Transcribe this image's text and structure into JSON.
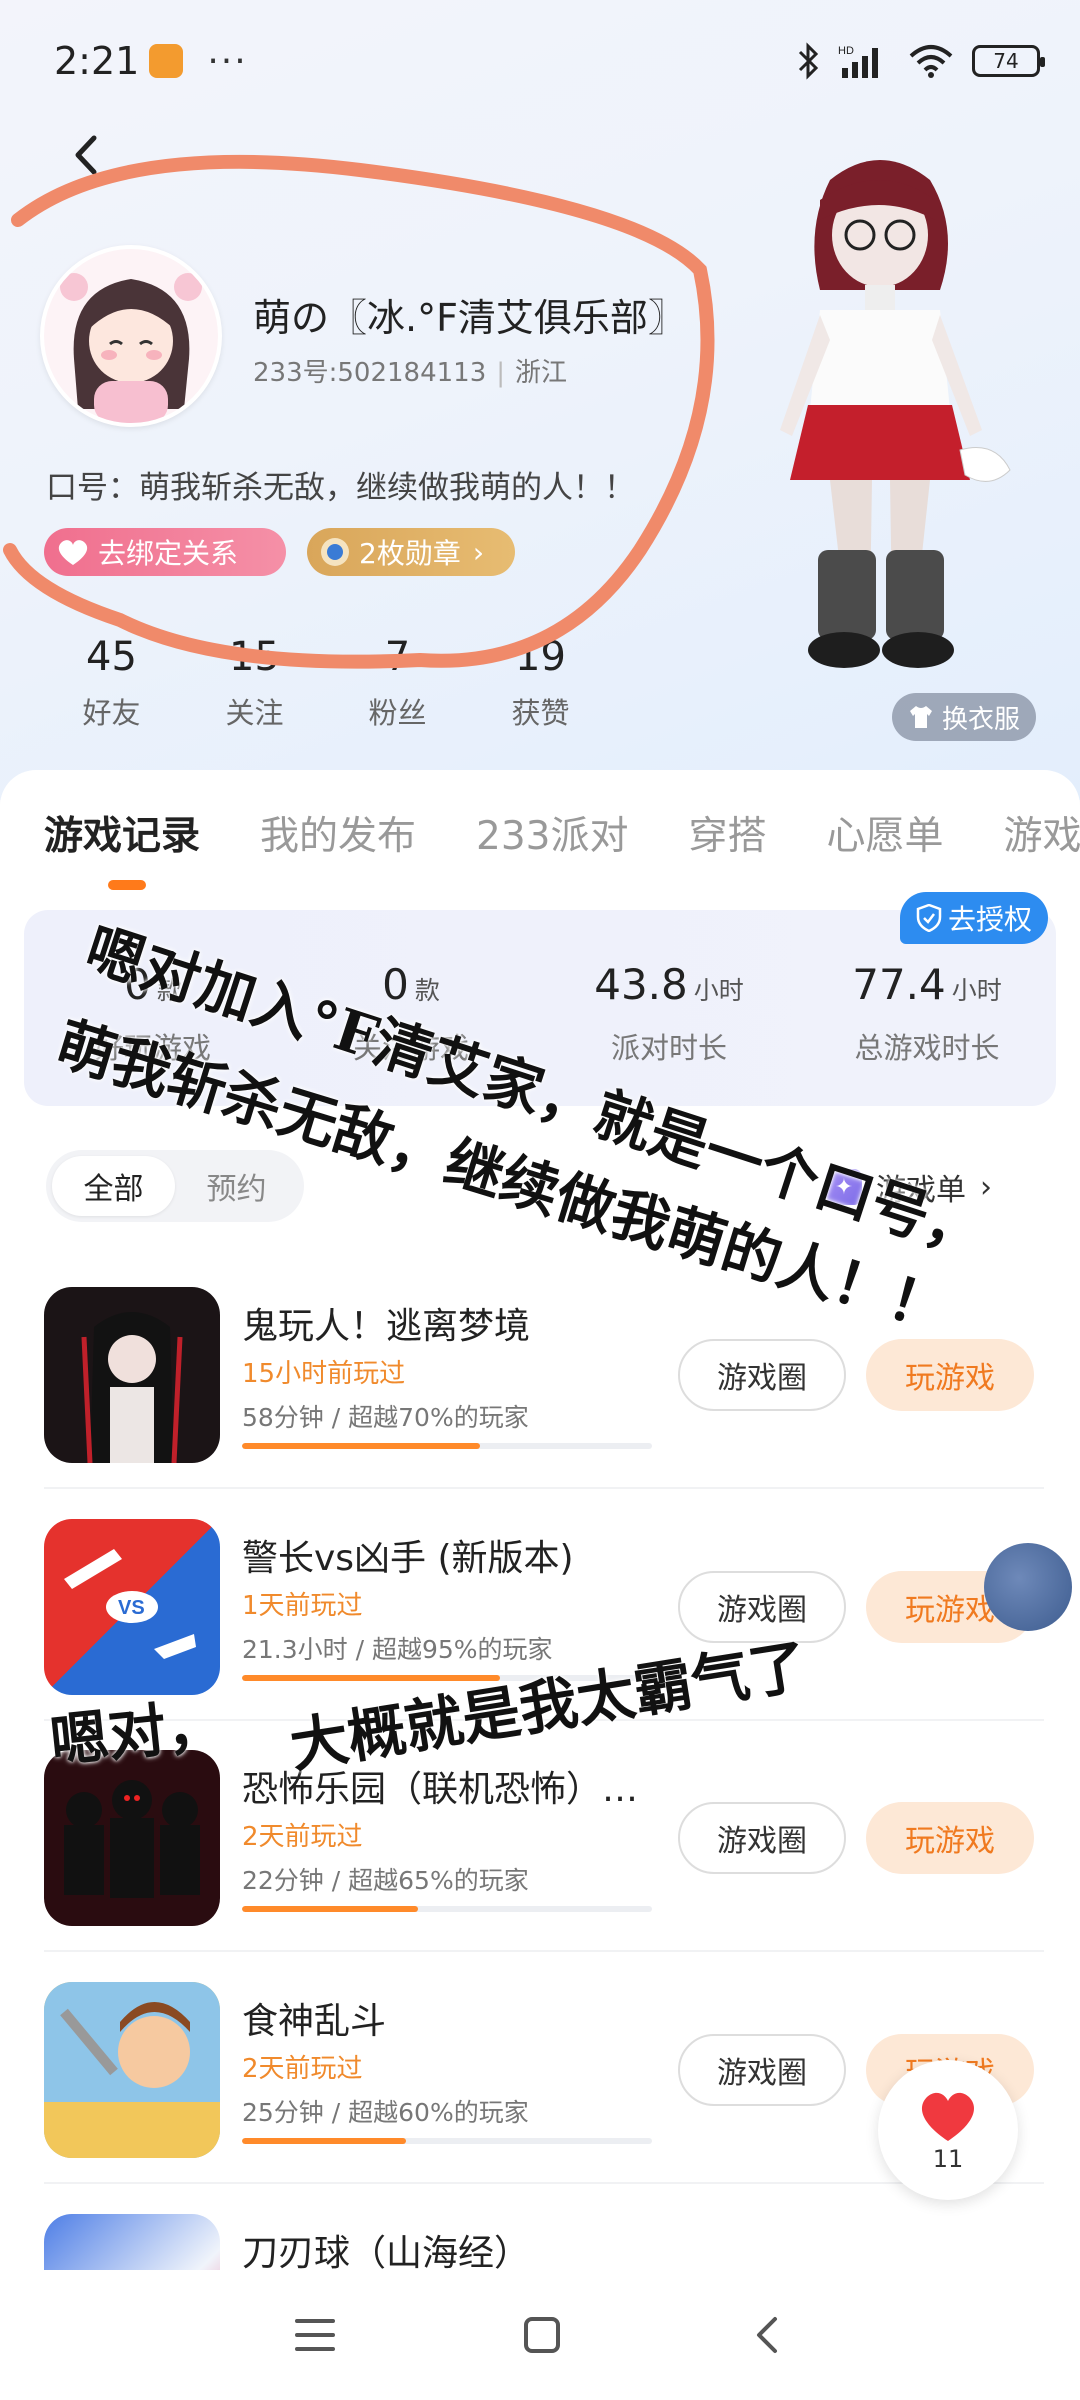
{
  "status_bar": {
    "time": "2:21",
    "dots": "···",
    "battery": "74",
    "network": "HD"
  },
  "profile": {
    "username": "萌の〖冰.°F清艾俱乐部〗",
    "id_label": "233号:502184113",
    "location": "浙江",
    "slogan": "口号：萌我斩杀无敌，继续做我萌的人！！",
    "bind_button": "去绑定关系",
    "medal_button": "2枚勋章",
    "wardrobe_button": "换衣服",
    "stats": [
      {
        "value": "45",
        "label": "好友"
      },
      {
        "value": "15",
        "label": "关注"
      },
      {
        "value": "7",
        "label": "粉丝"
      },
      {
        "value": "19",
        "label": "获赞"
      }
    ]
  },
  "tabs": [
    "游戏记录",
    "我的发布",
    "233派对",
    "穿搭",
    "心愿单",
    "游戏"
  ],
  "summary": {
    "auth_button": "去授权",
    "items": [
      {
        "value": "0",
        "unit": "款",
        "label": "好玩游戏"
      },
      {
        "value": "0",
        "unit": "款",
        "label": "关注游戏"
      },
      {
        "value": "43.8",
        "unit": "小时",
        "label": "派对时长"
      },
      {
        "value": "77.4",
        "unit": "小时",
        "label": "总游戏时长"
      }
    ]
  },
  "filter": {
    "all": "全部",
    "reserve": "预约"
  },
  "gamelist_link": "游戏单",
  "game_buttons": {
    "circle": "游戏圈",
    "play": "玩游戏"
  },
  "games": [
    {
      "title": "鬼玩人！逃离梦境",
      "time": "15小时前玩过",
      "stats": "58分钟 / 超越70%的玩家",
      "progress": 0.58
    },
    {
      "title": "警长vs凶手 (新版本)",
      "time": "1天前玩过",
      "stats": "21.3小时 / 超越95%的玩家",
      "progress": 0.63
    },
    {
      "title": "恐怖乐园（联机恐怖）…",
      "time": "2天前玩过",
      "stats": "22分钟 / 超越65%的玩家",
      "progress": 0.43
    },
    {
      "title": "食神乱斗",
      "time": "2天前玩过",
      "stats": "25分钟 / 超越60%的玩家",
      "progress": 0.4
    },
    {
      "title": "刀刃球（山海经）",
      "time": "",
      "stats": "",
      "progress": 0
    }
  ],
  "handwriting": [
    "嗯对加入°F清艾家，就是一个口号，",
    "萌我斩杀无敌，继续做我萌的人！！",
    "大概就是我太霸气了",
    "嗯对，"
  ],
  "like_count": "11"
}
